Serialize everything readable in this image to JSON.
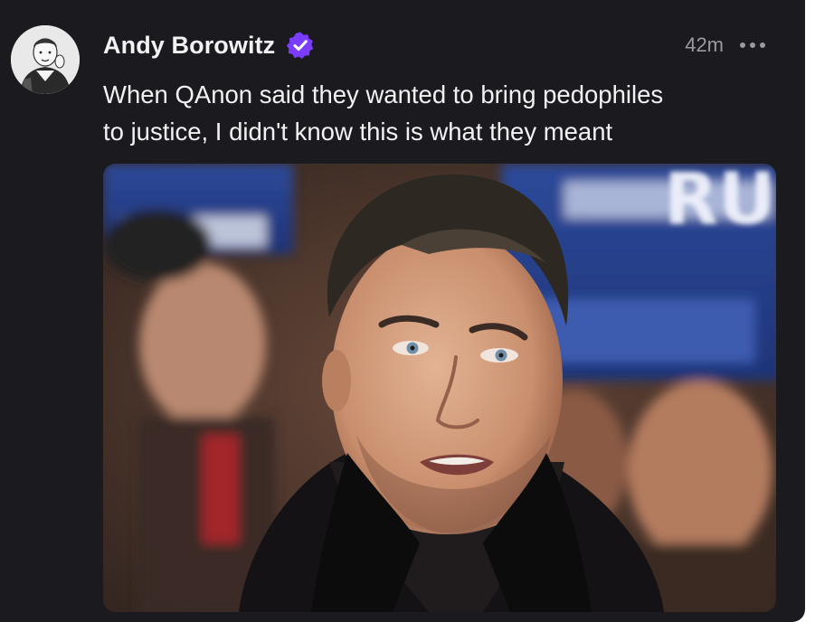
{
  "post": {
    "author_name": "Andy Borowitz",
    "verified_icon": "verified-badge-icon",
    "verified_color": "#7a3cff",
    "timestamp": "42m",
    "more_icon": "more-options-icon",
    "text_line1": "When QAnon said they wanted to bring pedophiles",
    "text_line2": "to justice, I didn't know this is what they meant",
    "media": {
      "type": "photo",
      "sign_text": "RUM"
    }
  },
  "colors": {
    "background": "#1b1b1f",
    "text": "#f2f2f4",
    "muted": "#9a9aa2",
    "accent": "#7a3cff"
  }
}
